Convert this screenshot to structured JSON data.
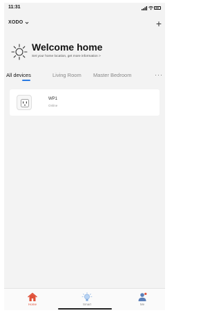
{
  "status_bar": {
    "time": "11:31"
  },
  "header": {
    "home_name": "XODO",
    "add_symbol": "+"
  },
  "welcome": {
    "title": "Welcome home",
    "subtitle": "Set your home location, get more information >"
  },
  "tabs": {
    "items": [
      {
        "label": "All devices",
        "active": true
      },
      {
        "label": "Living Room",
        "active": false
      },
      {
        "label": "Master Bedroom",
        "active": false
      }
    ],
    "more_symbol": "···"
  },
  "devices": [
    {
      "name": "WP1",
      "status": "Online",
      "icon": "smart-plug-icon"
    }
  ],
  "bottom_nav": {
    "items": [
      {
        "label": "Home",
        "icon": "home-icon",
        "active": true
      },
      {
        "label": "Smart",
        "icon": "smart-bulb-icon",
        "active": false
      },
      {
        "label": "Me",
        "icon": "user-icon",
        "active": false
      }
    ]
  },
  "colors": {
    "accent": "#2a7ae2",
    "home_active": "#e0523a",
    "background": "#f3f3f3"
  }
}
